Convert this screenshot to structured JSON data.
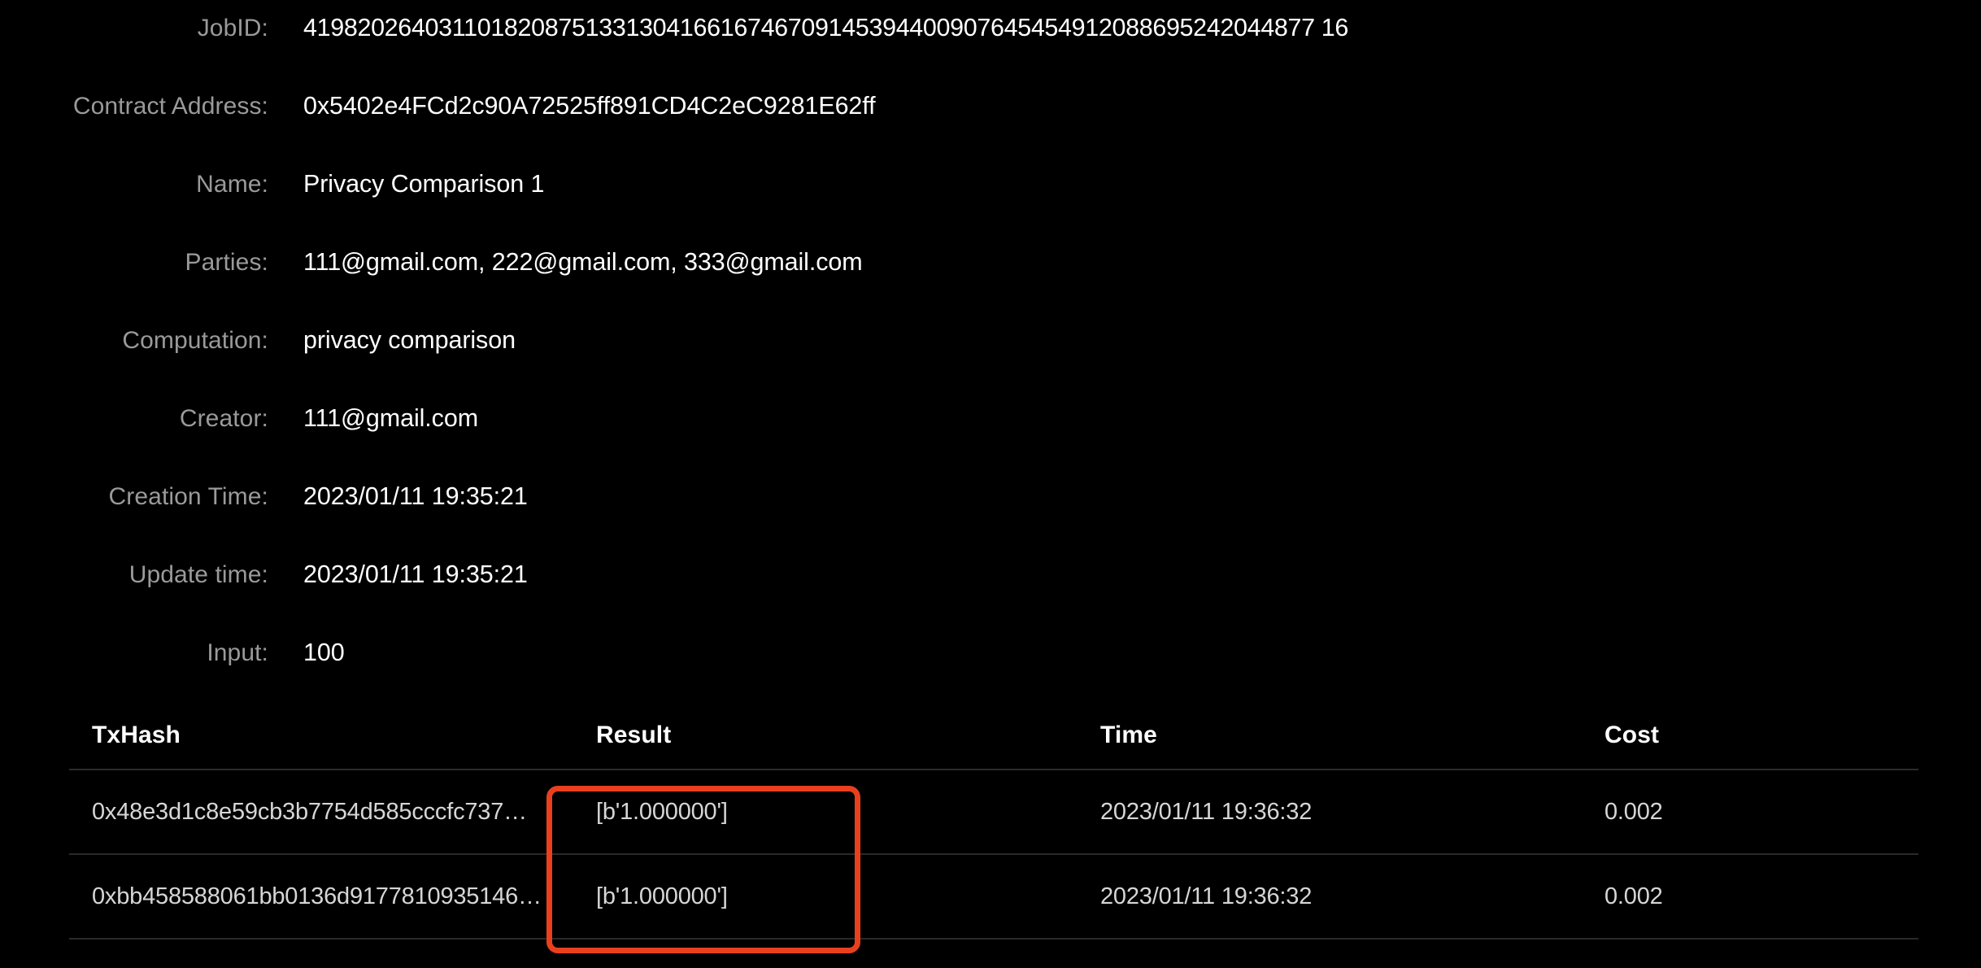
{
  "details": [
    {
      "label": "JobID:",
      "value": "419820264031101820875133130416616746709145394400907645454912088695242044877 16",
      "numeric": true
    },
    {
      "label": "Contract Address:",
      "value": "0x5402e4FCd2c90A72525ff891CD4C2eC9281E62ff",
      "numeric": false
    },
    {
      "label": "Name:",
      "value": "Privacy Comparison 1",
      "numeric": false
    },
    {
      "label": "Parties:",
      "value": "111@gmail.com, 222@gmail.com, 333@gmail.com",
      "numeric": false
    },
    {
      "label": "Computation:",
      "value": "privacy comparison",
      "numeric": false
    },
    {
      "label": "Creator:",
      "value": "111@gmail.com",
      "numeric": false
    },
    {
      "label": "Creation Time:",
      "value": "2023/01/11 19:35:21",
      "numeric": false
    },
    {
      "label": "Update time:",
      "value": "2023/01/11 19:35:21",
      "numeric": false
    },
    {
      "label": "Input:",
      "value": "100",
      "numeric": false
    }
  ],
  "tx_table": {
    "columns": [
      "TxHash",
      "Result",
      "Time",
      "Cost"
    ],
    "rows": [
      {
        "txhash": "0x48e3d1c8e59cb3b7754d585cccfc737…",
        "result": "[b'1.000000']",
        "time": "2023/01/11 19:36:32",
        "cost": "0.002"
      },
      {
        "txhash": "0xbb458588061bb0136d9177810935146…",
        "result": "[b'1.000000']",
        "time": "2023/01/11 19:36:32",
        "cost": "0.002"
      }
    ]
  },
  "annotation": {
    "highlight_color": "#e8401f",
    "target_column": "Result"
  },
  "theme": {
    "background": "#000000",
    "label_color": "#9a9a9a",
    "value_color": "#ffffff",
    "row_color": "#d6d6d6",
    "divider_color": "#2a2a2a"
  }
}
